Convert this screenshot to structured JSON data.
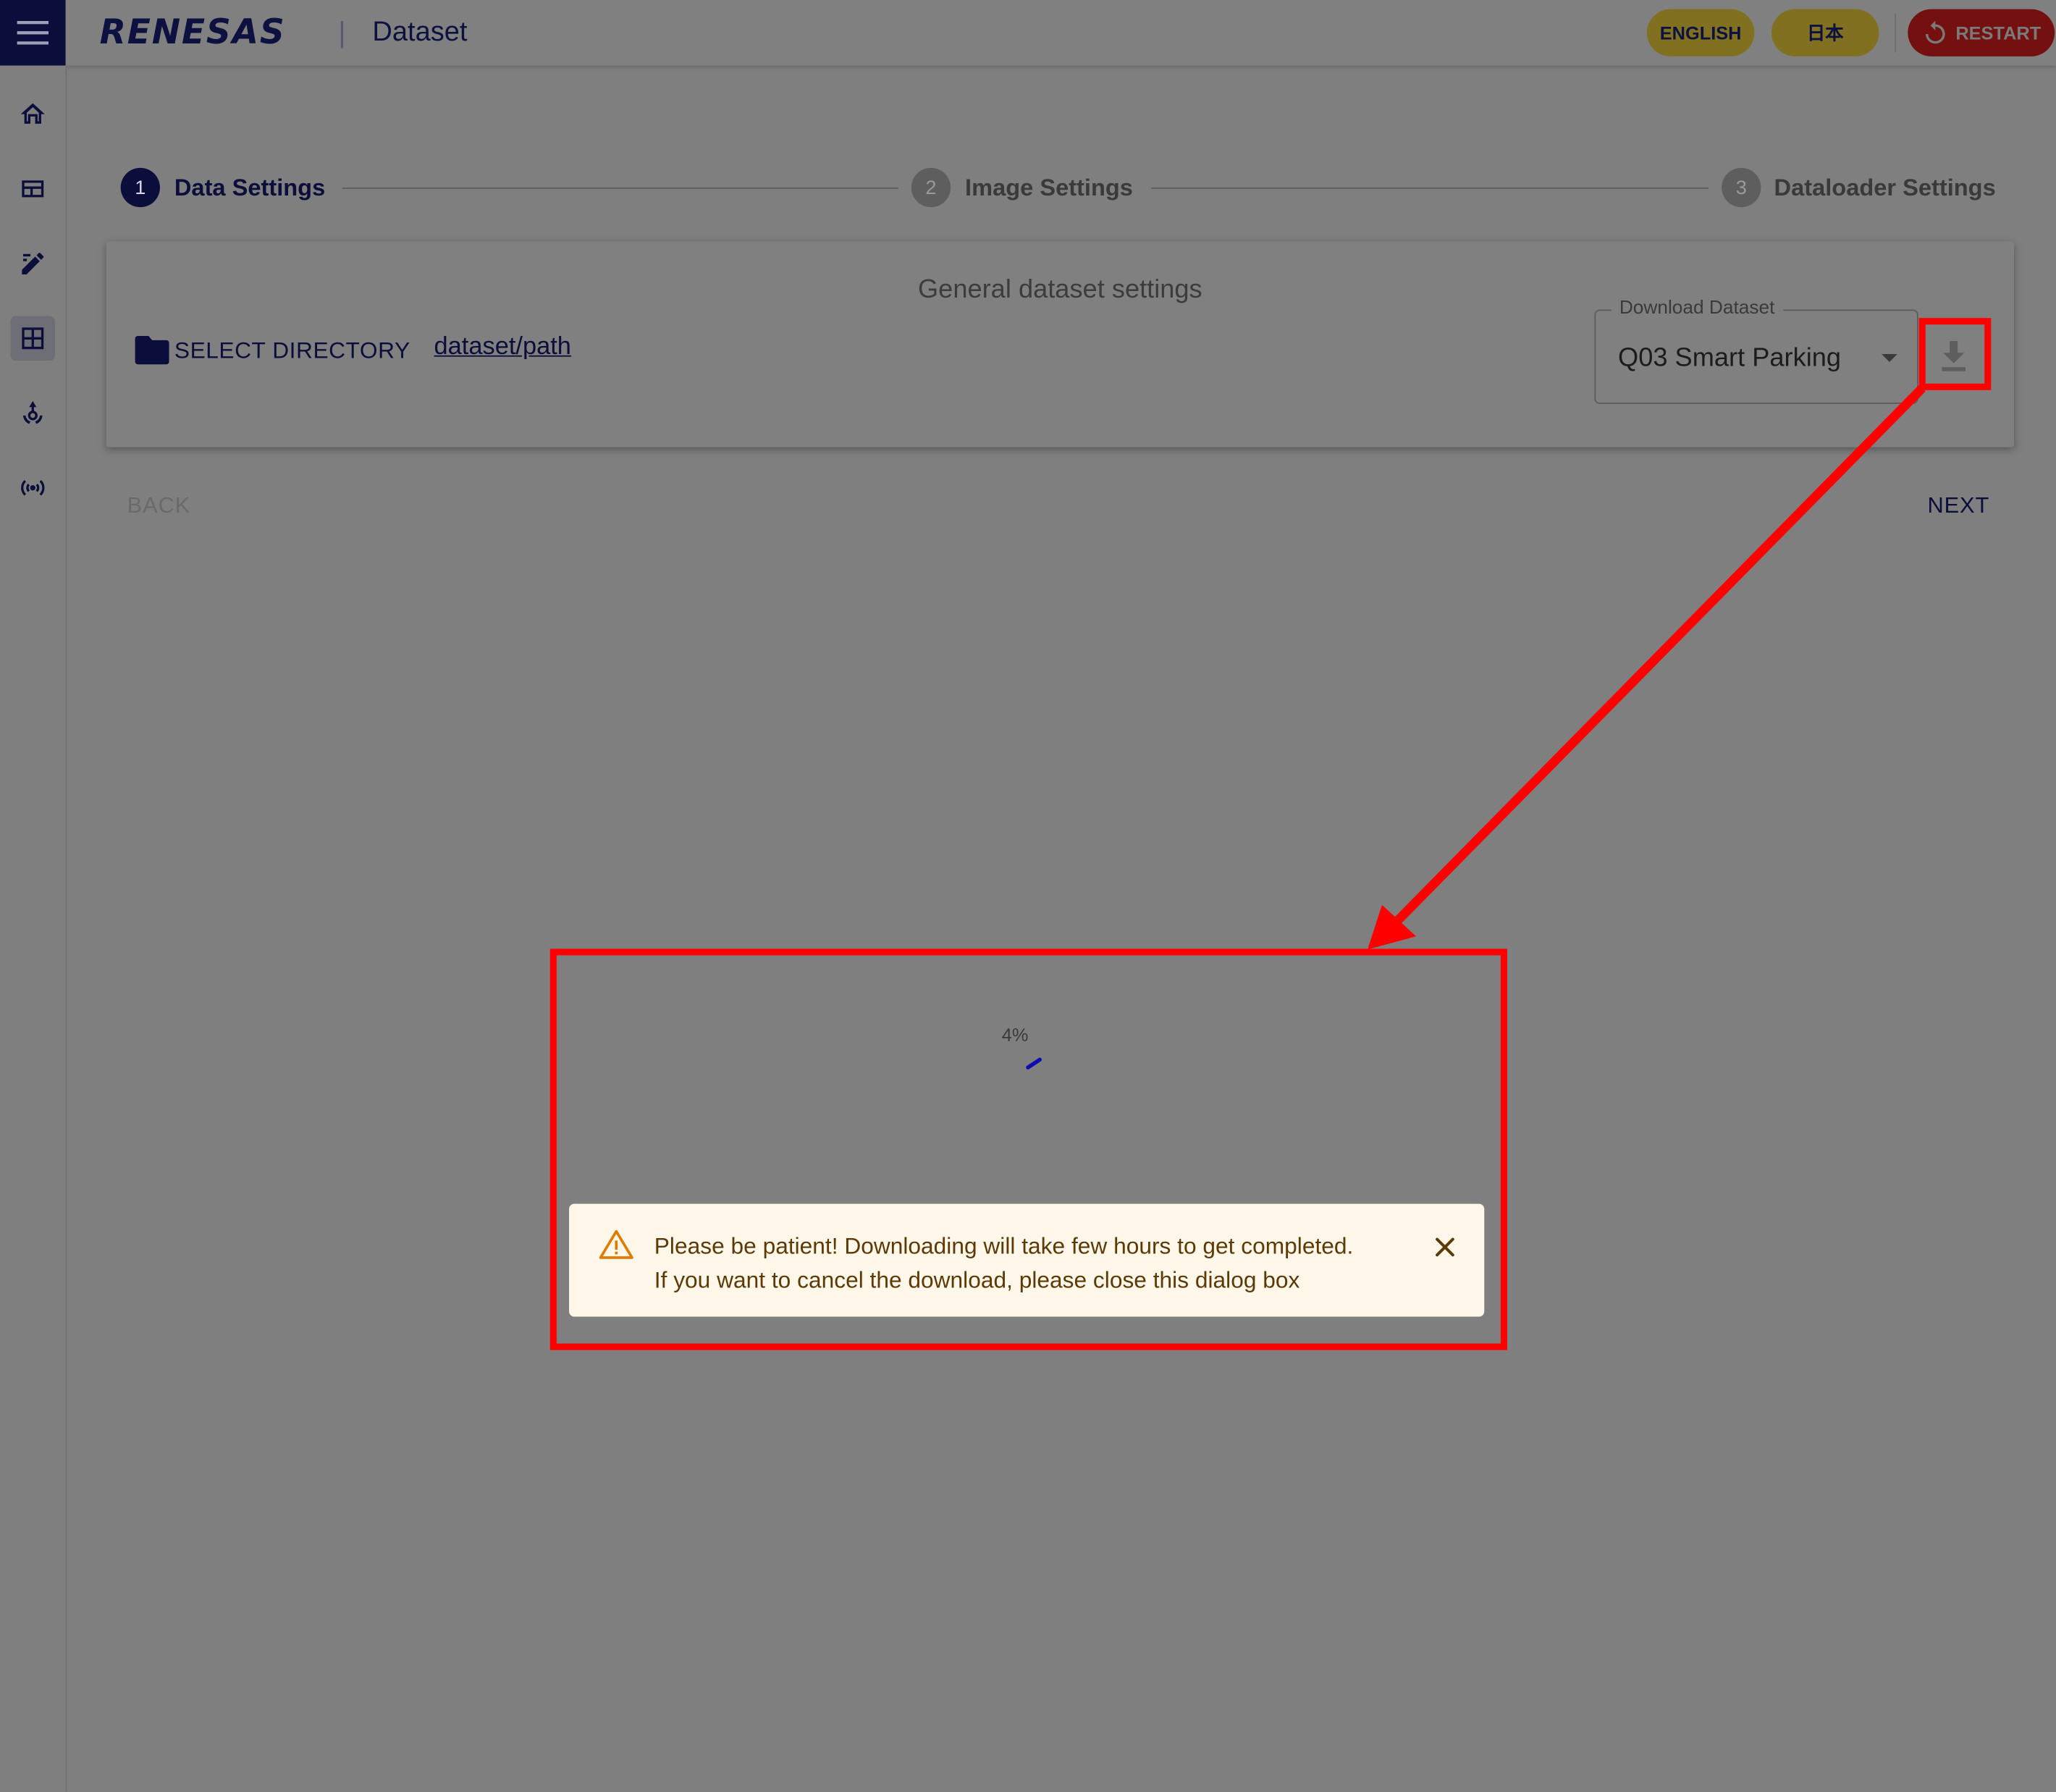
{
  "header": {
    "brand": "RENESAS",
    "separator": "|",
    "page_title": "Dataset",
    "lang_english": "ENGLISH",
    "lang_japanese": "日本",
    "restart_label": "RESTART"
  },
  "sidebar": {
    "items": [
      "home-icon",
      "dashboard-icon",
      "edit-icon",
      "dataset-icon",
      "deploy-icon",
      "broadcast-icon"
    ],
    "active": "dataset-icon"
  },
  "stepper": {
    "steps": [
      {
        "number": "1",
        "label": "Data Settings"
      },
      {
        "number": "2",
        "label": "Image Settings"
      },
      {
        "number": "3",
        "label": "Dataloader Settings"
      }
    ],
    "active_step": 1
  },
  "card": {
    "title": "General dataset settings",
    "select_directory_label": "SELECT DIRECTORY",
    "path": "dataset/path",
    "download_legend": "Download Dataset",
    "download_value": "Q03 Smart Parking"
  },
  "nav": {
    "back_label": "BACK",
    "next_label": "NEXT"
  },
  "progress": {
    "percent_text": "4%",
    "value": 0.04
  },
  "alert": {
    "line1": "Please be patient! Downloading will take few hours to get completed.",
    "line2": "If you want to cancel the download, please close this dialog box"
  },
  "colors": {
    "primary": "#0b0d3a",
    "overlay": "#7f7f7f",
    "annotation": "#ff0000",
    "alert_bg": "#fff7ea",
    "alert_text": "#5c3a06",
    "warning_icon": "#e07b00"
  }
}
